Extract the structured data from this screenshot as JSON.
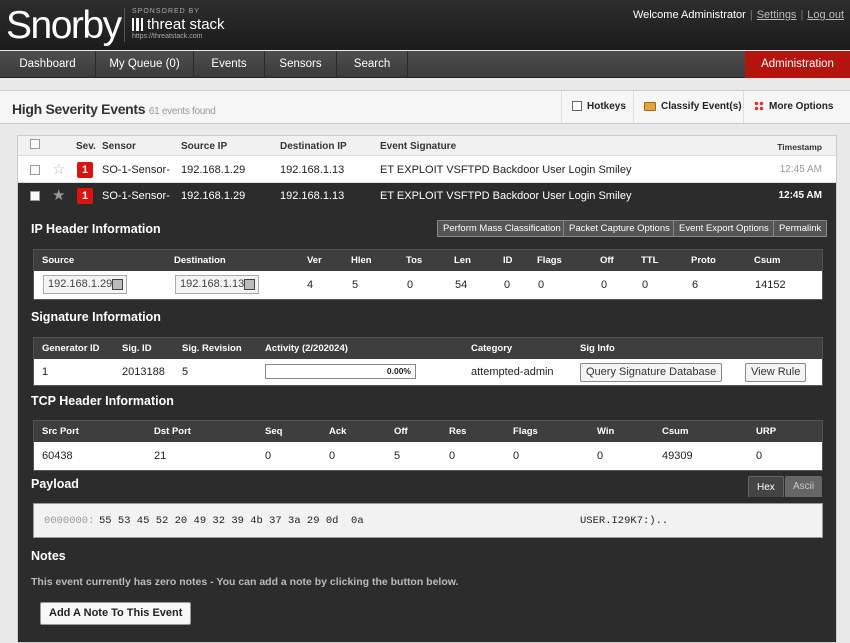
{
  "brand": {
    "logo": "Snorby",
    "sponsored_by": "SPONSORED BY",
    "sponsor_name": "threat stack",
    "sponsor_url": "https://threatstack.com"
  },
  "header": {
    "welcome": "Welcome Administrator",
    "settings": "Settings",
    "logout": "Log out"
  },
  "nav": {
    "tabs": [
      "Dashboard",
      "My Queue (0)",
      "Events",
      "Sensors",
      "Search"
    ],
    "admin": "Administration"
  },
  "page": {
    "title": "High Severity Events",
    "count": "61 events found",
    "hotkeys": "Hotkeys",
    "classify": "Classify Event(s)",
    "more": "More Options"
  },
  "events": {
    "headers": {
      "sev": "Sev.",
      "sensor": "Sensor",
      "src": "Source IP",
      "dst": "Destination IP",
      "sig": "Event Signature",
      "ts": "Timestamp"
    },
    "rows": [
      {
        "sev": "1",
        "sensor": "SO-1-Sensor-",
        "src": "192.168.1.29",
        "dst": "192.168.1.13",
        "sig": "ET EXPLOIT VSFTPD Backdoor User Login Smiley",
        "ts": "12:45 AM"
      },
      {
        "sev": "1",
        "sensor": "SO-1-Sensor-",
        "src": "192.168.1.29",
        "dst": "192.168.1.13",
        "sig": "ET EXPLOIT VSFTPD Backdoor User Login Smiley",
        "ts": "12:45 AM"
      }
    ]
  },
  "detail": {
    "ip_title": "IP Header Information",
    "buttons": [
      "Perform Mass Classification",
      "Packet Capture Options",
      "Event Export Options",
      "Permalink"
    ],
    "ip_headers": [
      "Source",
      "Destination",
      "Ver",
      "Hlen",
      "Tos",
      "Len",
      "ID",
      "Flags",
      "Off",
      "TTL",
      "Proto",
      "Csum"
    ],
    "ip_values": [
      "192.168.1.29",
      "192.168.1.13",
      "4",
      "5",
      "0",
      "54",
      "0",
      "0",
      "0",
      "0",
      "6",
      "14152"
    ],
    "sig_title": "Signature Information",
    "sig_headers": [
      "Generator ID",
      "Sig. ID",
      "Sig. Revision",
      "Activity (2/202024)",
      "Category",
      "Sig Info"
    ],
    "sig_values": {
      "gen": "1",
      "sid": "2013188",
      "rev": "5",
      "activity": "0.00%",
      "activity_fraction": 0.0,
      "category": "attempted-admin",
      "query": "Query Signature Database",
      "view": "View Rule"
    },
    "tcp_title": "TCP Header Information",
    "tcp_headers": [
      "Src Port",
      "Dst Port",
      "Seq",
      "Ack",
      "Off",
      "Res",
      "Flags",
      "Win",
      "Csum",
      "URP"
    ],
    "tcp_values": [
      "60438",
      "21",
      "0",
      "0",
      "5",
      "0",
      "0",
      "0",
      "49309",
      "0"
    ],
    "payload_title": "Payload",
    "payload_tabs": [
      "Hex",
      "Ascii"
    ],
    "payload": {
      "offset": "0000000:",
      "hex": "55 53 45 52 20 49 32 39 4b 37 3a 29 0d  0a",
      "ascii": "USER.I29K7:).."
    },
    "notes_title": "Notes",
    "notes_text": "This event currently has zero notes - You can add a note by clicking the button below.",
    "add_note": "Add A Note To This Event"
  }
}
